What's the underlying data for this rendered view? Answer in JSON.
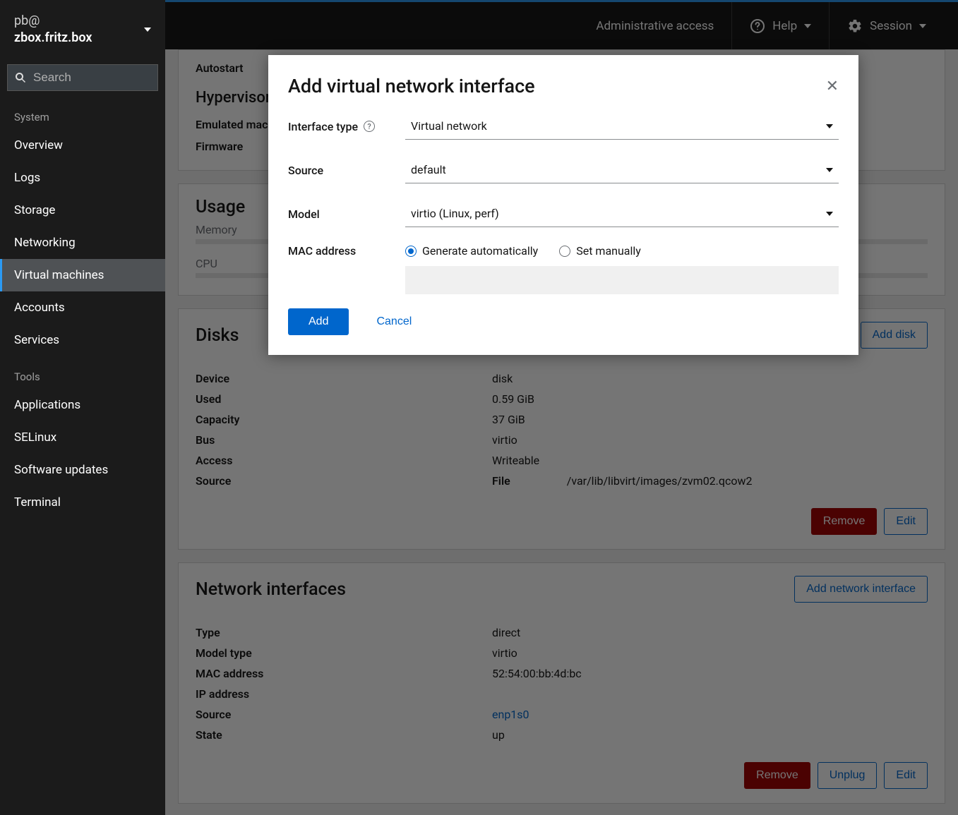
{
  "sidebar": {
    "user": "pb@",
    "hostname": "zbox.fritz.box",
    "search_placeholder": "Search",
    "sections": {
      "system": {
        "title": "System",
        "items": [
          "Overview",
          "Logs",
          "Storage",
          "Networking",
          "Virtual machines",
          "Accounts",
          "Services"
        ]
      },
      "tools": {
        "title": "Tools",
        "items": [
          "Applications",
          "SELinux",
          "Software updates",
          "Terminal"
        ]
      }
    },
    "active_item": "Virtual machines"
  },
  "topbar": {
    "admin": "Administrative access",
    "help": "Help",
    "session": "Session"
  },
  "main": {
    "overview_card": {
      "autostart": "Autostart",
      "hypervisor": "Hypervisor d",
      "emulated": "Emulated mach",
      "firmware": "Firmware"
    },
    "usage": {
      "title": "Usage",
      "memory": "Memory",
      "cpu": "CPU"
    },
    "disks": {
      "title": "Disks",
      "add_label": "Add disk",
      "rows": {
        "device_k": "Device",
        "device_v": "disk",
        "used_k": "Used",
        "used_v": "0.59 GiB",
        "capacity_k": "Capacity",
        "capacity_v": "37 GiB",
        "bus_k": "Bus",
        "bus_v": "virtio",
        "access_k": "Access",
        "access_v": "Writeable",
        "source_k": "Source",
        "source_sub_k": "File",
        "source_sub_v": "/var/lib/libvirt/images/zvm02.qcow2"
      },
      "remove": "Remove",
      "edit": "Edit"
    },
    "nics": {
      "title": "Network interfaces",
      "add_label": "Add network interface",
      "rows": {
        "type_k": "Type",
        "type_v": "direct",
        "model_k": "Model type",
        "model_v": "virtio",
        "mac_k": "MAC address",
        "mac_v": "52:54:00:bb:4d:bc",
        "ip_k": "IP address",
        "ip_v": "",
        "source_k": "Source",
        "source_v": "enp1s0",
        "state_k": "State",
        "state_v": "up"
      },
      "remove": "Remove",
      "unplug": "Unplug",
      "edit": "Edit"
    }
  },
  "modal": {
    "title": "Add virtual network interface",
    "fields": {
      "iface_type_label": "Interface type",
      "iface_type_value": "Virtual network",
      "source_label": "Source",
      "source_value": "default",
      "model_label": "Model",
      "model_value": "virtio (Linux, perf)",
      "mac_label": "MAC address",
      "mac_auto": "Generate automatically",
      "mac_manual": "Set manually"
    },
    "add": "Add",
    "cancel": "Cancel"
  }
}
